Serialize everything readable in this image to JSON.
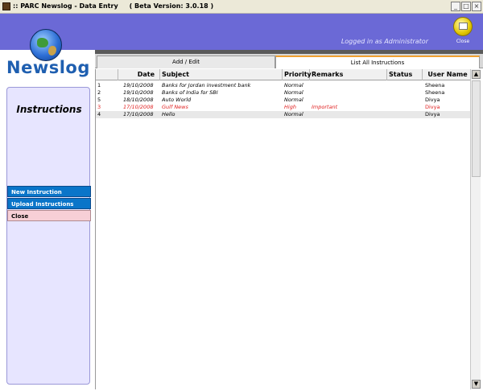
{
  "window": {
    "title": "PARC Newslog - Data Entry",
    "prefix": "::",
    "version": "( Beta Version: 3.0.18 )",
    "minimize": "_",
    "maximize": "□",
    "close": "×"
  },
  "header": {
    "logged_in": "Logged in as Administrator",
    "close_label": "Close"
  },
  "sidebar": {
    "logo": "Newslog",
    "panel_title": "Instructions",
    "items": [
      {
        "label": "New Instruction"
      },
      {
        "label": "Upload Instructions"
      },
      {
        "label": "Close"
      }
    ]
  },
  "tabs": [
    {
      "label": "Add / Edit"
    },
    {
      "label": "List All Instructions"
    }
  ],
  "table": {
    "columns": [
      "",
      "Date",
      "Subject",
      "Priority",
      "Remarks",
      "Status",
      "User Name"
    ],
    "rows": [
      {
        "id": "1",
        "date": "19/10/2008",
        "subject": "Banks for Jordan investment bank",
        "priority": "Normal",
        "remarks": "",
        "status": "",
        "user": "Sheena"
      },
      {
        "id": "2",
        "date": "19/10/2008",
        "subject": "Banks of India for SBI",
        "priority": "Normal",
        "remarks": "",
        "status": "",
        "user": "Sheena"
      },
      {
        "id": "5",
        "date": "18/10/2008",
        "subject": "Auto World",
        "priority": "Normal",
        "remarks": "",
        "status": "",
        "user": "Divya"
      },
      {
        "id": "3",
        "date": "17/10/2008",
        "subject": "Gulf News",
        "priority": "High",
        "remarks": "Important",
        "status": "",
        "user": "Divya",
        "important": true
      },
      {
        "id": "4",
        "date": "17/10/2008",
        "subject": "Hello",
        "priority": "Normal",
        "remarks": "",
        "status": "",
        "user": "Divya"
      }
    ]
  },
  "colors": {
    "header_bg": "#6b69d6",
    "accent_blue": "#0a75c9",
    "important_red": "#e02020",
    "panel_bg": "#e7e5ff"
  }
}
